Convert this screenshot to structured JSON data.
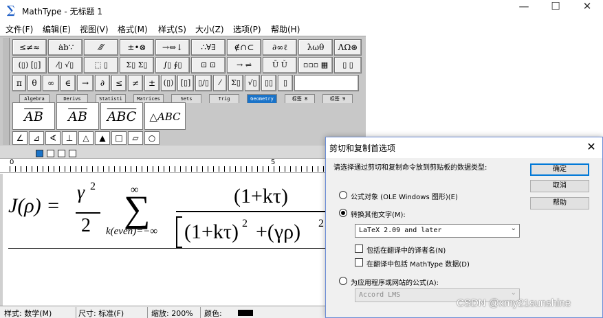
{
  "window": {
    "app_icon": "∑",
    "title": "MathType - 无标题 1",
    "minimize": "—",
    "maximize": "☐",
    "close": "✕"
  },
  "menu": [
    "文件(F)",
    "编辑(E)",
    "视图(V)",
    "格式(M)",
    "样式(S)",
    "大小(Z)",
    "选项(P)",
    "帮助(H)"
  ],
  "toolbar": {
    "row1": [
      "≤≠≈",
      " ȧb∵",
      "⁄⁄⁄",
      "±•⊗",
      "→⇔↓",
      "∴∀∃",
      "∉∩⊂",
      "∂∞ℓ",
      "λωθ",
      "ΛΩ⊛"
    ],
    "row2": [
      "(▯) [▯]",
      "⁄▯ √▯",
      "⬚ ▯",
      "Σ▯ Σ▯",
      "∫▯ ∮▯",
      "⊡ ⊡",
      "→ ⇌",
      "Ū Ǔ",
      "▫▫▫ ▦",
      "▯ ▯"
    ],
    "row3": [
      "π",
      "θ",
      "∞",
      "∈",
      "→",
      "∂",
      "≤",
      "≠",
      "±",
      "(▯)",
      "[▯]",
      "▯/▯",
      "⁄",
      "Σ▯",
      "√▯",
      "▯▯",
      "▯"
    ],
    "tabs": [
      "Algebra",
      "Derivs",
      "Statisti",
      "Matrices",
      "Sets",
      "Trig",
      "Geometry",
      "标签 8",
      "标签 9"
    ],
    "active_tab": "Geometry",
    "templates": [
      "AB",
      "AB",
      "ABC",
      "△ABC"
    ],
    "templates_row2": [
      "∠",
      "⊿",
      "∢",
      "⊥",
      "△",
      "▲",
      "□",
      "▱",
      "○"
    ]
  },
  "ruler": {
    "marks": [
      "0",
      "5"
    ]
  },
  "equation": {
    "lhs": "J(ρ) =",
    "frac1_num": "γ",
    "frac1_num_exp": "2",
    "frac1_den": "2",
    "sum_symbol": "∑",
    "sum_upper": "∞",
    "sum_lower": "k(even)=−∞",
    "frac2_num": "(1+kτ)",
    "frac2_den": "(1+kτ)",
    "frac2_den_exp": "2",
    "frac2_den_plus": "+(γρ)",
    "frac2_den_exp2": "2"
  },
  "statusbar": {
    "style": "样式: 数学(M)",
    "size": "尺寸: 标准(F)",
    "zoom": "缩放: 200%",
    "color": "颜色:",
    "color_value": "#000000"
  },
  "dialog": {
    "title": "剪切和复制首选项",
    "close": "✕",
    "prompt": "请选择通过剪切和复制命令放到剪贴板的数据类型:",
    "option1": "公式对象 (OLE Windows 图形)(E)",
    "option2": "转换其他文字(M):",
    "translator": "LaTeX 2.09 and later",
    "check1": "包括在翻译中的译者名(N)",
    "check2": "在翻译中包括 MathType 数据(D)",
    "option3": "为应用程序或网站的公式(A):",
    "app_select": "Accord LMS",
    "ok": "确定",
    "cancel": "取消",
    "help": "帮助",
    "selected_option": 2,
    "check1_checked": false,
    "check2_checked": false
  },
  "watermark": "CSDN @xmy21sunshine",
  "colors": {
    "accent": "#1a73c8",
    "dialog_border": "#6b8dd6",
    "toolbar_bg": "#c8c8c8"
  }
}
